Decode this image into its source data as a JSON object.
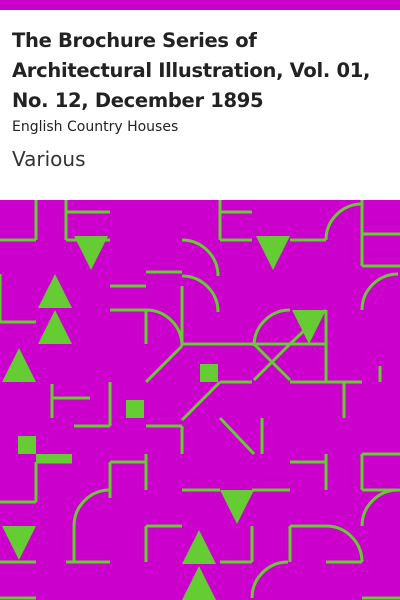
{
  "book": {
    "title": "The Brochure Series of Architectural Illustration, Vol. 01, No. 12, December 1895",
    "subtitle": "English Country Houses",
    "author": "Various"
  },
  "colors": {
    "background": "#cc00cc",
    "pattern": "#66cc33",
    "title_text": "#222222",
    "page": "#ffffff"
  }
}
